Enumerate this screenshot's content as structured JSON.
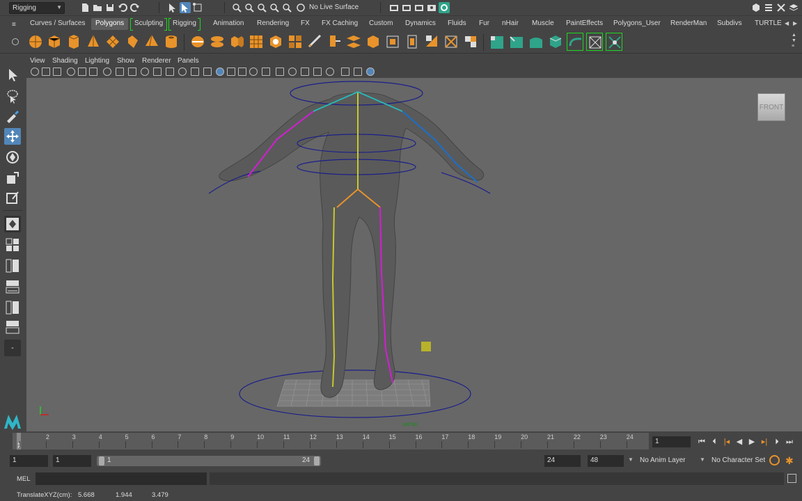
{
  "statusline": {
    "menu_set": "Rigging",
    "live_surface": "No Live Surface"
  },
  "shelf_tabs": [
    "Curves / Surfaces",
    "Polygons",
    "Sculpting",
    "Rigging",
    "Animation",
    "Rendering",
    "FX",
    "FX Caching",
    "Custom",
    "Dynamics",
    "Fluids",
    "Fur",
    "nHair",
    "Muscle",
    "PaintEffects",
    "Polygons_User",
    "RenderMan",
    "Subdivs",
    "TURTLE"
  ],
  "active_shelf_tab": "Polygons",
  "panel_menu": [
    "View",
    "Shading",
    "Lighting",
    "Show",
    "Renderer",
    "Panels"
  ],
  "viewport": {
    "camera": "persp",
    "view_cube_label": "FRONT"
  },
  "timeslider": {
    "ticks": [
      "1",
      "2",
      "3",
      "4",
      "5",
      "6",
      "7",
      "8",
      "9",
      "10",
      "11",
      "12",
      "13",
      "14",
      "15",
      "16",
      "17",
      "18",
      "19",
      "20",
      "21",
      "22",
      "23",
      "24"
    ],
    "current_frame_marker": "1",
    "current_frame": "1"
  },
  "range": {
    "anim_start": "1",
    "playback_start": "1",
    "range_bar_start": "1",
    "range_bar_end": "24",
    "playback_end": "24",
    "anim_end": "48",
    "anim_layer": "No Anim Layer",
    "character_set": "No Character Set"
  },
  "command": {
    "mel_label": "MEL"
  },
  "help_line": {
    "label": "TranslateXYZ(cm):",
    "x": "5.668",
    "y": "1.944",
    "z": "3.479"
  },
  "colors": {
    "ui_bg": "#444444",
    "viewport_bg": "#676767",
    "active_tool": "#5286b9",
    "shelf_orange": "#e8932b",
    "shelf_teal": "#2fa48a",
    "joint_magenta": "#d21fd2",
    "joint_yellow": "#c8c82b",
    "control_blue": "#1b1f8a"
  }
}
